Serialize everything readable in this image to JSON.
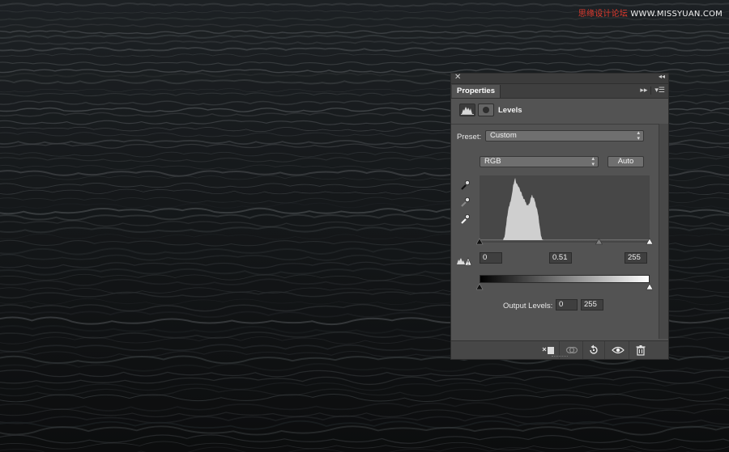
{
  "watermark": {
    "prefix": "思缘设计论坛",
    "site": "WWW.MISSYUAN.COM"
  },
  "panel": {
    "close_icon": "close-icon",
    "collapse_icon": "double-chevron-icon",
    "tab_label": "Properties",
    "tab_expand_icon": "expand-icon",
    "panel_menu_icon": "panel-menu-icon",
    "adjustment_title": "Levels",
    "preset_label": "Preset:",
    "preset_value": "Custom",
    "channel_value": "RGB",
    "auto_label": "Auto",
    "input_black": "0",
    "input_gamma": "0.51",
    "input_white": "255",
    "output_label": "Output Levels:",
    "output_black": "0",
    "output_white": "255"
  },
  "histogram": {
    "bins": [
      0,
      0,
      0,
      0,
      0,
      0,
      0,
      0,
      0,
      0,
      0,
      0,
      0,
      0,
      0,
      0,
      0,
      0,
      0,
      0,
      0,
      0,
      0,
      0,
      0,
      0,
      0,
      0,
      0,
      0,
      0,
      0,
      0,
      0,
      0,
      0,
      0,
      0,
      1,
      3,
      6,
      10,
      18,
      26,
      35,
      42,
      48,
      52,
      56,
      60,
      64,
      68,
      72,
      80,
      88,
      92,
      96,
      98,
      94,
      90,
      92,
      88,
      84,
      86,
      82,
      80,
      78,
      75,
      72,
      70,
      68,
      66,
      64,
      62,
      60,
      58,
      56,
      55,
      56,
      58,
      60,
      62,
      66,
      70,
      72,
      70,
      68,
      66,
      64,
      60,
      56,
      52,
      48,
      44,
      38,
      30,
      22,
      14,
      8,
      4,
      2,
      1,
      0,
      0,
      0,
      0,
      0,
      0,
      0,
      0,
      0,
      0,
      0,
      0,
      0,
      0,
      0,
      0,
      0,
      0,
      0,
      0,
      0,
      0,
      0,
      0,
      0,
      0,
      0,
      0,
      0,
      0,
      0,
      0,
      0,
      0,
      0,
      0,
      0,
      0,
      0,
      0,
      0,
      0,
      0,
      0,
      0,
      0,
      0,
      0,
      0,
      0,
      0,
      0,
      0,
      0,
      0,
      0,
      0,
      0,
      0,
      0,
      0,
      0,
      0,
      0,
      0,
      0,
      0,
      0,
      0,
      0,
      0,
      0,
      0,
      0,
      0,
      0,
      0,
      0,
      0,
      0,
      0,
      0,
      0,
      0,
      0,
      0,
      0,
      0,
      0,
      0,
      0,
      0,
      0,
      0,
      0,
      0,
      0,
      0,
      0,
      0,
      0,
      0,
      0,
      0,
      0,
      0,
      0,
      0,
      0,
      0,
      0,
      0,
      0,
      0,
      0,
      0,
      0,
      0,
      0,
      0,
      0,
      0,
      0,
      0,
      0,
      0,
      0,
      0,
      0,
      0,
      0,
      0,
      0,
      0,
      0,
      0,
      0,
      0,
      0,
      0,
      0,
      0,
      0,
      0,
      0,
      0,
      0,
      0,
      0,
      0,
      0,
      0,
      0,
      0,
      0,
      0,
      0,
      0,
      0,
      0,
      0,
      0,
      0,
      0,
      0,
      0,
      0,
      0,
      0,
      0,
      0
    ],
    "input_black_fraction": 0,
    "gamma_fraction": 0.702,
    "input_white_fraction": 1,
    "output_black_fraction": 0,
    "output_white_fraction": 1
  },
  "bottom_icons": [
    "clip-to-layer-icon",
    "view-previous-icon",
    "reset-icon",
    "visibility-icon",
    "delete-icon"
  ]
}
